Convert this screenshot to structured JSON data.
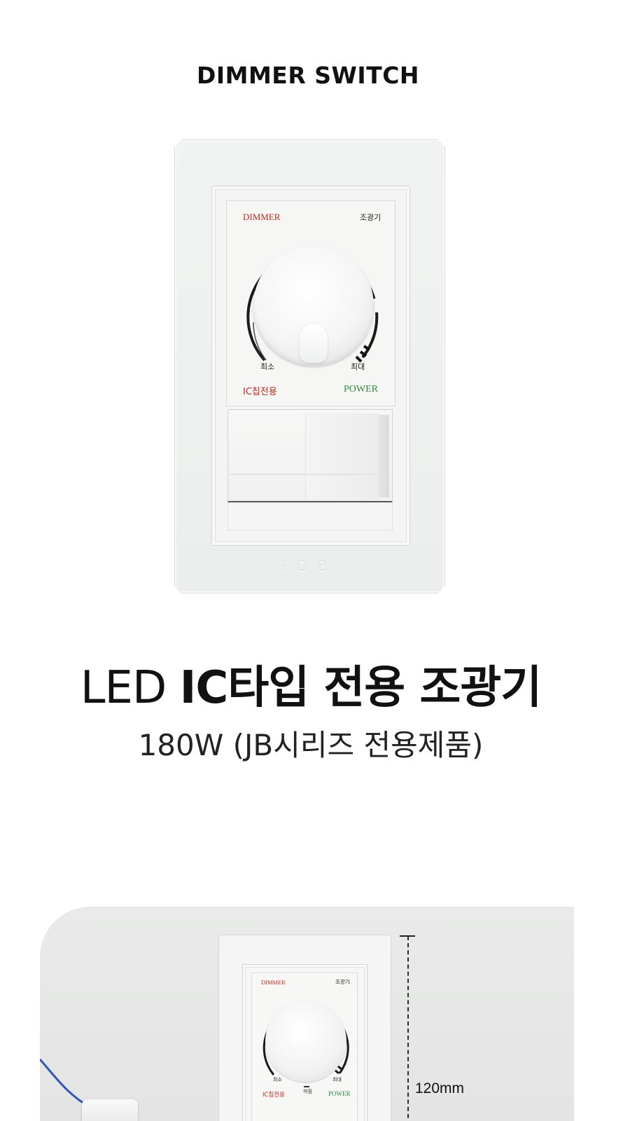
{
  "section_title": "DIMMER SWITCH",
  "product_photo": {
    "label_dimmer": "DIMMER",
    "label_dimmer_ko": "조광기",
    "label_min": "최소",
    "label_max": "최대",
    "label_ic_only": "IC칩전용",
    "label_power": "POWER",
    "brand_mark": "JOB",
    "accent_red": "#c8281e",
    "accent_green": "#2e8c3c"
  },
  "headline": {
    "light_part": "LED",
    "bold_part": "IC타입 전용 조광기"
  },
  "subheadline": "180W (JB시리즈 전용제품)",
  "dimension_photo": {
    "label_dimmer": "DIMMER",
    "label_dimmer_ko": "조광기",
    "label_min": "최소",
    "label_max": "최대",
    "label_off": "꺼짐",
    "label_ic_only": "IC칩전용",
    "label_power": "POWER",
    "height_label": "120mm"
  }
}
